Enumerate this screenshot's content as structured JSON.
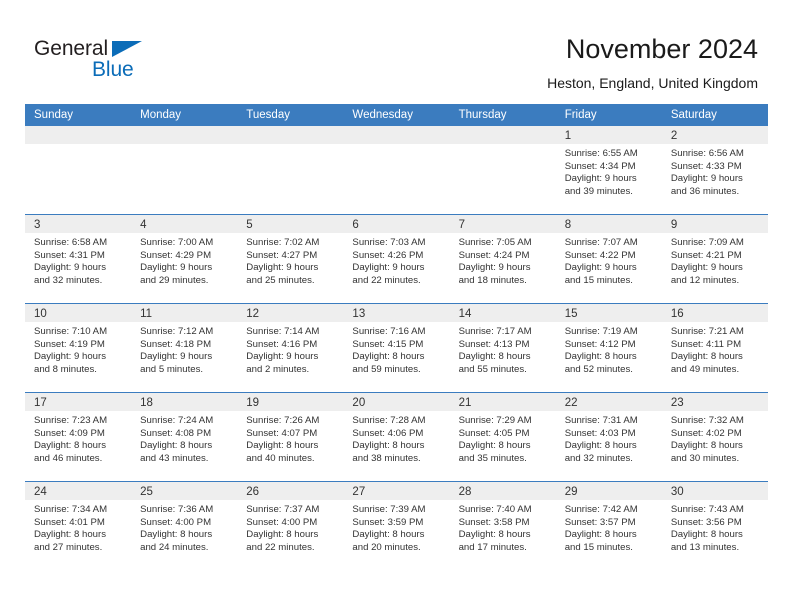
{
  "brand": {
    "word_one": "General",
    "word_two": "Blue",
    "triangle_icon": "triangle-icon",
    "accent_color": "#0b6cb8"
  },
  "header": {
    "title": "November 2024",
    "subtitle": "Heston, England, United Kingdom"
  },
  "theme": {
    "header_bar_color": "#3b7cbf",
    "daynum_band_color": "#eeeeee",
    "text_color": "#333333"
  },
  "weekdays": [
    "Sunday",
    "Monday",
    "Tuesday",
    "Wednesday",
    "Thursday",
    "Friday",
    "Saturday"
  ],
  "weeks": [
    [
      {
        "day": "",
        "empty": true
      },
      {
        "day": "",
        "empty": true
      },
      {
        "day": "",
        "empty": true
      },
      {
        "day": "",
        "empty": true
      },
      {
        "day": "",
        "empty": true
      },
      {
        "day": "1",
        "sunrise": "Sunrise: 6:55 AM",
        "sunset": "Sunset: 4:34 PM",
        "daylight1": "Daylight: 9 hours",
        "daylight2": "and 39 minutes."
      },
      {
        "day": "2",
        "sunrise": "Sunrise: 6:56 AM",
        "sunset": "Sunset: 4:33 PM",
        "daylight1": "Daylight: 9 hours",
        "daylight2": "and 36 minutes."
      }
    ],
    [
      {
        "day": "3",
        "sunrise": "Sunrise: 6:58 AM",
        "sunset": "Sunset: 4:31 PM",
        "daylight1": "Daylight: 9 hours",
        "daylight2": "and 32 minutes."
      },
      {
        "day": "4",
        "sunrise": "Sunrise: 7:00 AM",
        "sunset": "Sunset: 4:29 PM",
        "daylight1": "Daylight: 9 hours",
        "daylight2": "and 29 minutes."
      },
      {
        "day": "5",
        "sunrise": "Sunrise: 7:02 AM",
        "sunset": "Sunset: 4:27 PM",
        "daylight1": "Daylight: 9 hours",
        "daylight2": "and 25 minutes."
      },
      {
        "day": "6",
        "sunrise": "Sunrise: 7:03 AM",
        "sunset": "Sunset: 4:26 PM",
        "daylight1": "Daylight: 9 hours",
        "daylight2": "and 22 minutes."
      },
      {
        "day": "7",
        "sunrise": "Sunrise: 7:05 AM",
        "sunset": "Sunset: 4:24 PM",
        "daylight1": "Daylight: 9 hours",
        "daylight2": "and 18 minutes."
      },
      {
        "day": "8",
        "sunrise": "Sunrise: 7:07 AM",
        "sunset": "Sunset: 4:22 PM",
        "daylight1": "Daylight: 9 hours",
        "daylight2": "and 15 minutes."
      },
      {
        "day": "9",
        "sunrise": "Sunrise: 7:09 AM",
        "sunset": "Sunset: 4:21 PM",
        "daylight1": "Daylight: 9 hours",
        "daylight2": "and 12 minutes."
      }
    ],
    [
      {
        "day": "10",
        "sunrise": "Sunrise: 7:10 AM",
        "sunset": "Sunset: 4:19 PM",
        "daylight1": "Daylight: 9 hours",
        "daylight2": "and 8 minutes."
      },
      {
        "day": "11",
        "sunrise": "Sunrise: 7:12 AM",
        "sunset": "Sunset: 4:18 PM",
        "daylight1": "Daylight: 9 hours",
        "daylight2": "and 5 minutes."
      },
      {
        "day": "12",
        "sunrise": "Sunrise: 7:14 AM",
        "sunset": "Sunset: 4:16 PM",
        "daylight1": "Daylight: 9 hours",
        "daylight2": "and 2 minutes."
      },
      {
        "day": "13",
        "sunrise": "Sunrise: 7:16 AM",
        "sunset": "Sunset: 4:15 PM",
        "daylight1": "Daylight: 8 hours",
        "daylight2": "and 59 minutes."
      },
      {
        "day": "14",
        "sunrise": "Sunrise: 7:17 AM",
        "sunset": "Sunset: 4:13 PM",
        "daylight1": "Daylight: 8 hours",
        "daylight2": "and 55 minutes."
      },
      {
        "day": "15",
        "sunrise": "Sunrise: 7:19 AM",
        "sunset": "Sunset: 4:12 PM",
        "daylight1": "Daylight: 8 hours",
        "daylight2": "and 52 minutes."
      },
      {
        "day": "16",
        "sunrise": "Sunrise: 7:21 AM",
        "sunset": "Sunset: 4:11 PM",
        "daylight1": "Daylight: 8 hours",
        "daylight2": "and 49 minutes."
      }
    ],
    [
      {
        "day": "17",
        "sunrise": "Sunrise: 7:23 AM",
        "sunset": "Sunset: 4:09 PM",
        "daylight1": "Daylight: 8 hours",
        "daylight2": "and 46 minutes."
      },
      {
        "day": "18",
        "sunrise": "Sunrise: 7:24 AM",
        "sunset": "Sunset: 4:08 PM",
        "daylight1": "Daylight: 8 hours",
        "daylight2": "and 43 minutes."
      },
      {
        "day": "19",
        "sunrise": "Sunrise: 7:26 AM",
        "sunset": "Sunset: 4:07 PM",
        "daylight1": "Daylight: 8 hours",
        "daylight2": "and 40 minutes."
      },
      {
        "day": "20",
        "sunrise": "Sunrise: 7:28 AM",
        "sunset": "Sunset: 4:06 PM",
        "daylight1": "Daylight: 8 hours",
        "daylight2": "and 38 minutes."
      },
      {
        "day": "21",
        "sunrise": "Sunrise: 7:29 AM",
        "sunset": "Sunset: 4:05 PM",
        "daylight1": "Daylight: 8 hours",
        "daylight2": "and 35 minutes."
      },
      {
        "day": "22",
        "sunrise": "Sunrise: 7:31 AM",
        "sunset": "Sunset: 4:03 PM",
        "daylight1": "Daylight: 8 hours",
        "daylight2": "and 32 minutes."
      },
      {
        "day": "23",
        "sunrise": "Sunrise: 7:32 AM",
        "sunset": "Sunset: 4:02 PM",
        "daylight1": "Daylight: 8 hours",
        "daylight2": "and 30 minutes."
      }
    ],
    [
      {
        "day": "24",
        "sunrise": "Sunrise: 7:34 AM",
        "sunset": "Sunset: 4:01 PM",
        "daylight1": "Daylight: 8 hours",
        "daylight2": "and 27 minutes."
      },
      {
        "day": "25",
        "sunrise": "Sunrise: 7:36 AM",
        "sunset": "Sunset: 4:00 PM",
        "daylight1": "Daylight: 8 hours",
        "daylight2": "and 24 minutes."
      },
      {
        "day": "26",
        "sunrise": "Sunrise: 7:37 AM",
        "sunset": "Sunset: 4:00 PM",
        "daylight1": "Daylight: 8 hours",
        "daylight2": "and 22 minutes."
      },
      {
        "day": "27",
        "sunrise": "Sunrise: 7:39 AM",
        "sunset": "Sunset: 3:59 PM",
        "daylight1": "Daylight: 8 hours",
        "daylight2": "and 20 minutes."
      },
      {
        "day": "28",
        "sunrise": "Sunrise: 7:40 AM",
        "sunset": "Sunset: 3:58 PM",
        "daylight1": "Daylight: 8 hours",
        "daylight2": "and 17 minutes."
      },
      {
        "day": "29",
        "sunrise": "Sunrise: 7:42 AM",
        "sunset": "Sunset: 3:57 PM",
        "daylight1": "Daylight: 8 hours",
        "daylight2": "and 15 minutes."
      },
      {
        "day": "30",
        "sunrise": "Sunrise: 7:43 AM",
        "sunset": "Sunset: 3:56 PM",
        "daylight1": "Daylight: 8 hours",
        "daylight2": "and 13 minutes."
      }
    ]
  ]
}
